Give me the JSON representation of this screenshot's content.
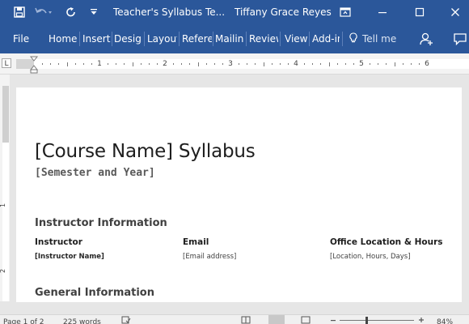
{
  "titlebar": {
    "document_title": "Teacher's Syllabus Te...",
    "user_name": "Tiffany Grace Reyes",
    "icons": [
      "save-icon",
      "undo-icon",
      "redo-icon",
      "customize-qat-icon",
      "ribbon-display-options-icon",
      "minimize-icon",
      "maximize-icon",
      "close-icon"
    ]
  },
  "ribbon": {
    "tabs": [
      "File",
      "Home",
      "Insert",
      "Design",
      "Layout",
      "References",
      "Mailings",
      "Review",
      "View",
      "Add-ins"
    ],
    "tell_me_placeholder": "Tell me",
    "icons": [
      "lightbulb-icon",
      "share-person-icon",
      "comments-icon"
    ]
  },
  "ruler": {
    "tab_selector": "L",
    "numbers": [
      "1",
      "2",
      "3",
      "4",
      "5",
      "6"
    ],
    "vertical_numbers": [
      "1",
      "2"
    ]
  },
  "document": {
    "title": "[Course Name] Syllabus",
    "subtitle": "[Semester and Year]",
    "section_instructor": "Instructor Information",
    "columns": [
      {
        "label": "Instructor",
        "value": "[Instructor Name]"
      },
      {
        "label": "Email",
        "value": "[Email address]"
      },
      {
        "label": "Office Location & Hours",
        "value": "[Location, Hours, Days]"
      }
    ],
    "section_general": "General Information"
  },
  "statusbar": {
    "page_info": "Page 1 of 2",
    "word_count": "225 words",
    "zoom": "84%"
  },
  "colors": {
    "brand": "#2b579a",
    "page": "#ffffff",
    "workspace": "#e6e6e6"
  }
}
